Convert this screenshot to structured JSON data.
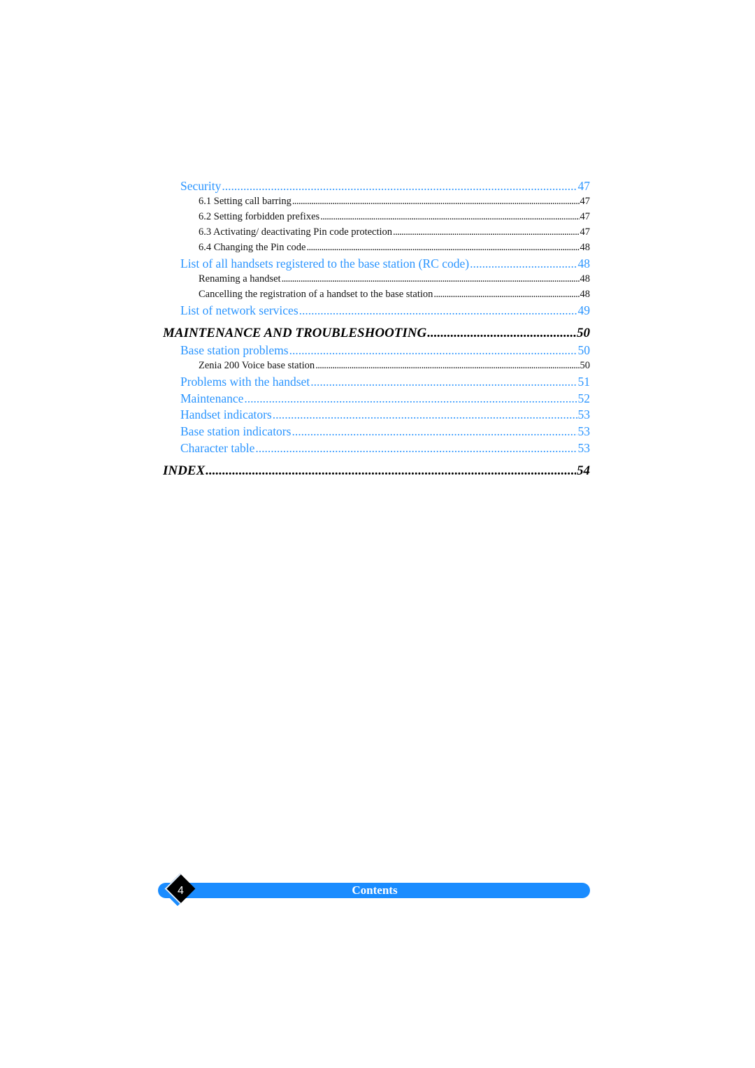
{
  "toc": {
    "entries": [
      {
        "level": 2,
        "title": "Security",
        "page": "47"
      },
      {
        "level": 3,
        "title": "6.1 Setting call barring",
        "page": "47"
      },
      {
        "level": 3,
        "title": "6.2 Setting forbidden prefixes",
        "page": "47"
      },
      {
        "level": 3,
        "title": "6.3 Activating/ deactivating Pin code protection",
        "page": "47"
      },
      {
        "level": 3,
        "title": "6.4 Changing the Pin code",
        "page": "48"
      },
      {
        "level": 2,
        "title": "List of all handsets registered to the base station (RC code)",
        "page": "48"
      },
      {
        "level": 3,
        "title": "Renaming a handset",
        "page": "48"
      },
      {
        "level": 3,
        "title": "Cancelling the registration of a handset to the base station",
        "page": "48"
      },
      {
        "level": 2,
        "title": "List of network services",
        "page": "49"
      },
      {
        "level": 1,
        "title": "MAINTENANCE AND TROUBLESHOOTING",
        "page": "50"
      },
      {
        "level": 2,
        "title": "Base station problems",
        "page": "50"
      },
      {
        "level": 3,
        "title": "Zenia 200 Voice base station",
        "page": "50"
      },
      {
        "level": 2,
        "title": "Problems with the handset",
        "page": "51"
      },
      {
        "level": 2,
        "title": "Maintenance",
        "page": "52"
      },
      {
        "level": 2,
        "title": "Handset indicators",
        "page": "53"
      },
      {
        "level": 2,
        "title": "Base station indicators",
        "page": "53"
      },
      {
        "level": 2,
        "title": "Character table",
        "page": "53"
      },
      {
        "level": 1,
        "title": "INDEX",
        "page": "54"
      }
    ]
  },
  "footer": {
    "page_number": "4",
    "section_label": "Contents",
    "accent_color": "#1a8cff",
    "link_color": "#2b95ff"
  }
}
